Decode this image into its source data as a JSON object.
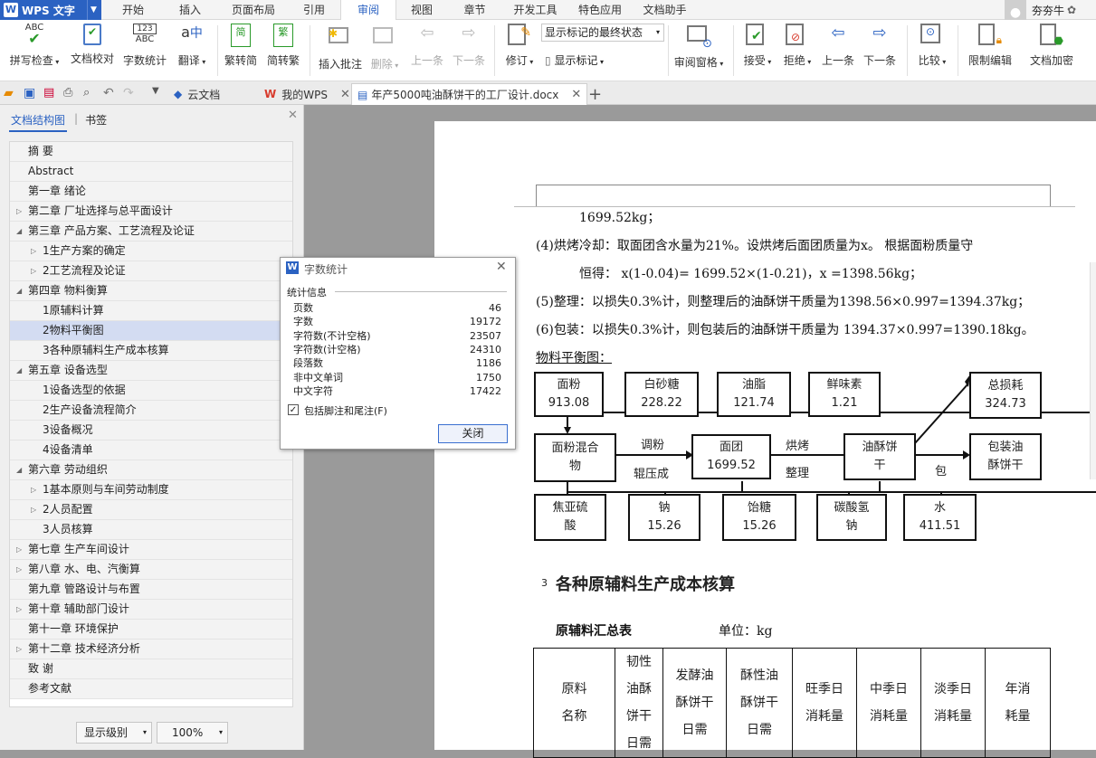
{
  "app": {
    "brand": "WPS 文字",
    "user": "夯夯牛"
  },
  "menus": [
    "开始",
    "插入",
    "页面布局",
    "引用",
    "审阅",
    "视图",
    "章节",
    "开发工具",
    "特色应用",
    "文档助手"
  ],
  "active_menu": "审阅",
  "ribbon": {
    "spell": "拼写检查",
    "proof": "文档校对",
    "wordcount": "字数统计",
    "translate": "翻译",
    "t2s": "繁转简",
    "s2t": "简转繁",
    "add_comment": "插入批注",
    "delete": "删除",
    "prev": "上一条",
    "next": "下一条",
    "track": "修订",
    "show_marks": "显示标记",
    "markup_state": "显示标记的最终状态",
    "review_pane": "审阅窗格",
    "accept": "接受",
    "reject": "拒绝",
    "prev2": "上一条",
    "next2": "下一条",
    "compare": "比较",
    "restrict": "限制编辑",
    "encrypt": "文档加密"
  },
  "tabs": {
    "cloud": "云文档",
    "mywps": "我的WPS",
    "doc": "年产5000吨油酥饼干的工厂设计.docx"
  },
  "leftpanel": {
    "tab1": "文档结构图",
    "tab2": "书签",
    "items": [
      {
        "t": "摘  要",
        "lvl": 1,
        "arrow": ""
      },
      {
        "t": "Abstract",
        "lvl": 1,
        "arrow": ""
      },
      {
        "t": "第一章 绪论",
        "lvl": 1,
        "arrow": ""
      },
      {
        "t": "第二章 厂址选择与总平面设计",
        "lvl": 1,
        "arrow": "r"
      },
      {
        "t": "第三章 产品方案、工艺流程及论证",
        "lvl": 1,
        "arrow": "d"
      },
      {
        "t": "1生产方案的确定",
        "lvl": 2,
        "arrow": "r"
      },
      {
        "t": "2工艺流程及论证",
        "lvl": 2,
        "arrow": "r"
      },
      {
        "t": "第四章 物料衡算",
        "lvl": 1,
        "arrow": "d"
      },
      {
        "t": "1原辅料计算",
        "lvl": 2,
        "arrow": ""
      },
      {
        "t": "2物料平衡图",
        "lvl": 2,
        "arrow": "",
        "sel": true
      },
      {
        "t": "3各种原辅料生产成本核算",
        "lvl": 2,
        "arrow": ""
      },
      {
        "t": "第五章 设备选型",
        "lvl": 1,
        "arrow": "d"
      },
      {
        "t": "1设备选型的依据",
        "lvl": 2,
        "arrow": ""
      },
      {
        "t": "2生产设备流程简介",
        "lvl": 2,
        "arrow": ""
      },
      {
        "t": "3设备概况",
        "lvl": 2,
        "arrow": ""
      },
      {
        "t": "4设备清单",
        "lvl": 2,
        "arrow": ""
      },
      {
        "t": "第六章 劳动组织",
        "lvl": 1,
        "arrow": "d"
      },
      {
        "t": "1基本原则与车间劳动制度",
        "lvl": 2,
        "arrow": "r"
      },
      {
        "t": "2人员配置",
        "lvl": 2,
        "arrow": "r"
      },
      {
        "t": "3人员核算",
        "lvl": 2,
        "arrow": ""
      },
      {
        "t": "第七章 生产车间设计",
        "lvl": 1,
        "arrow": "r"
      },
      {
        "t": "第八章 水、电、汽衡算",
        "lvl": 1,
        "arrow": "r"
      },
      {
        "t": "第九章 管路设计与布置",
        "lvl": 1,
        "arrow": ""
      },
      {
        "t": "第十章 辅助部门设计",
        "lvl": 1,
        "arrow": "r"
      },
      {
        "t": "第十一章 环境保护",
        "lvl": 1,
        "arrow": ""
      },
      {
        "t": "第十二章 技术经济分析",
        "lvl": 1,
        "arrow": "r"
      },
      {
        "t": "致  谢",
        "lvl": 1,
        "arrow": ""
      },
      {
        "t": "参考文献",
        "lvl": 1,
        "arrow": ""
      }
    ],
    "level_btn": "显示级别",
    "zoom": "100%"
  },
  "dialog": {
    "title": "字数统计",
    "section": "统计信息",
    "rows": [
      {
        "k": "页数",
        "v": "46"
      },
      {
        "k": "字数",
        "v": "19172"
      },
      {
        "k": "字符数(不计空格)",
        "v": "23507"
      },
      {
        "k": "字符数(计空格)",
        "v": "24310"
      },
      {
        "k": "段落数",
        "v": "1186"
      },
      {
        "k": "非中文单词",
        "v": "1750"
      },
      {
        "k": "中文字符",
        "v": "17422"
      }
    ],
    "checkbox": "包括脚注和尾注(F)",
    "close": "关闭"
  },
  "doc": {
    "l1": "1699.52kg；",
    "l2": "(4)烘烤冷却：取面团含水量为21%。设烘烤后面团质量为x。 根据面粉质量守",
    "l3": "恒得： x(1-0.04)= 1699.52×(1-0.21)，x =1398.56kg；",
    "l4": "(5)整理：以损失0.3%计，则整理后的油酥饼干质量为1398.56×0.997=1394.37kg；",
    "l5": "(6)包装：以损失0.3%计，则包装后的油酥饼干质量为 1394.37×0.997=1390.18kg。",
    "l6": "物料平衡图：",
    "flow": {
      "flour": [
        "面粉",
        "913.08"
      ],
      "sugar": [
        "白砂糖",
        "228.22"
      ],
      "fat": [
        "油脂",
        "121.74"
      ],
      "msg": [
        "鲜味素",
        "1.21"
      ],
      "loss": [
        "总损耗",
        "324.73"
      ],
      "mix": [
        "面粉混合",
        "物"
      ],
      "dough": [
        "面团",
        "1699.52"
      ],
      "biscuit": [
        "油酥饼",
        "干"
      ],
      "packed": [
        "包装油",
        "酥饼干"
      ],
      "sulfite": [
        "焦亚硫",
        "酸"
      ],
      "sodium": [
        "钠",
        "15.26"
      ],
      "malt": [
        "饴糖",
        "15.26"
      ],
      "bicarb": [
        "碳酸氢",
        "钠"
      ],
      "water": [
        "水",
        "411.51"
      ],
      "a1": "调粉",
      "a2": "辊压成",
      "a3": "烘烤",
      "a4": "整理",
      "a5": "包"
    },
    "heading_no": "3",
    "heading": "各种原辅料生产成本核算",
    "table_title": "原辅料汇总表",
    "unit": "单位：kg",
    "cols": [
      [
        "原料",
        "名称"
      ],
      [
        "韧性",
        "油酥",
        "饼干",
        "日需"
      ],
      [
        "发酵油",
        "酥饼干",
        "日需"
      ],
      [
        "酥性油",
        "酥饼干",
        "日需"
      ],
      [
        "旺季日",
        "消耗量"
      ],
      [
        "中季日",
        "消耗量"
      ],
      [
        "淡季日",
        "消耗量"
      ],
      [
        "年消",
        "耗量"
      ]
    ]
  },
  "colors": {
    "accent": "#2b62c2",
    "selected": "#d3dcf2"
  }
}
